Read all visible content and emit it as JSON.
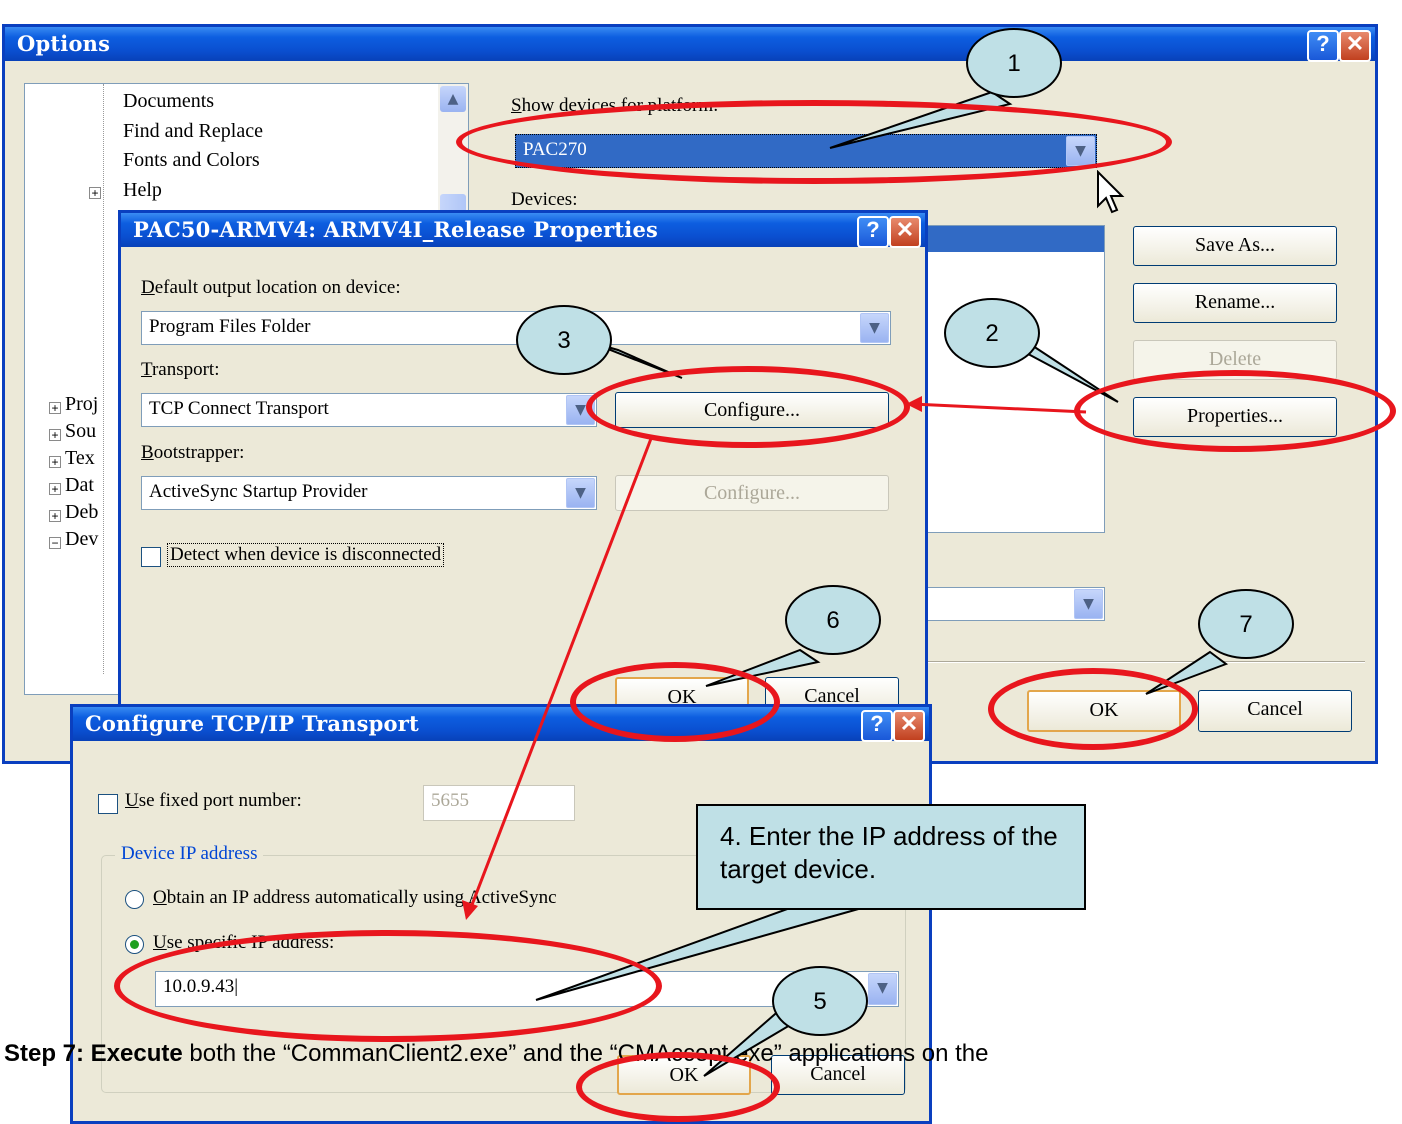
{
  "options_dialog": {
    "title": "Options",
    "tree_items": [
      "Documents",
      "Find and Replace",
      "Fonts and Colors",
      "Help"
    ],
    "tree_partial": [
      "Proj",
      "Sou",
      "Tex",
      "Dat",
      "Deb",
      "Dev"
    ],
    "platform_label": "Show devices for platform:",
    "platform_value": "PAC270",
    "devices_label": "Devices:",
    "buttons": {
      "save_as": "Save As...",
      "rename": "Rename...",
      "delete": "Delete",
      "properties": "Properties...",
      "ok": "OK",
      "cancel": "Cancel"
    }
  },
  "properties_dialog": {
    "title": "PAC50-ARMV4: ARMV4I_Release Properties",
    "output_label": "Default output location on device:",
    "output_value": "Program Files Folder",
    "transport_label": "Transport:",
    "transport_value": "TCP Connect Transport",
    "configure_label": "Configure...",
    "bootstrapper_label": "Bootstrapper:",
    "bootstrapper_value": "ActiveSync Startup Provider",
    "configure_disabled_label": "Configure...",
    "detect_label": "Detect when device is disconnected",
    "ok": "OK",
    "cancel": "Cancel"
  },
  "tcp_dialog": {
    "title": "Configure TCP/IP Transport",
    "fixed_port_label": "Use fixed port number:",
    "port_value": "5655",
    "group_label": "Device IP address",
    "obtain_label": "Obtain an IP address automatically using ActiveSync",
    "specific_label": "Use specific IP address:",
    "ip_value": "10.0.9.43",
    "ok": "OK",
    "cancel": "Cancel"
  },
  "callouts": [
    "1",
    "2",
    "3",
    "4. Enter the IP address of the target device.",
    "5",
    "6",
    "7"
  ],
  "step_text": {
    "step": "Step 7: Execute",
    "rest": " both the “CommanClient2.exe” and the “CMAccept.exe” applications on the"
  },
  "colors": {
    "annotation_red": "#e8161d",
    "callout_fill": "#bfe0e6",
    "title_blue": "#0a4fd0"
  }
}
